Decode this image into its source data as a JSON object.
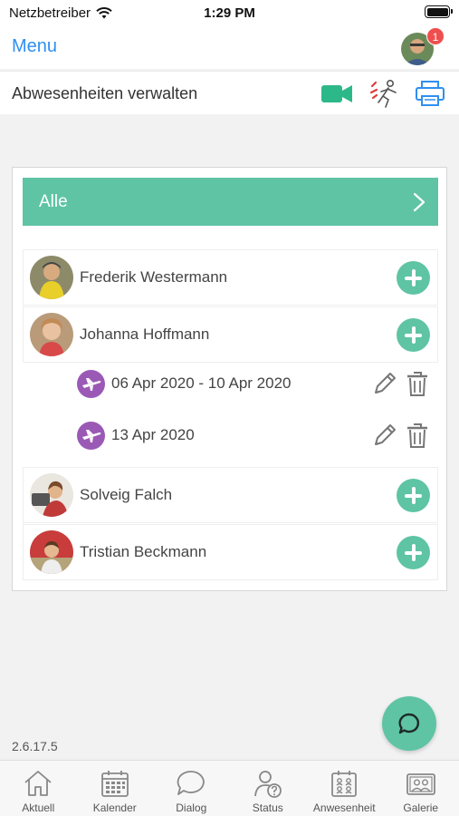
{
  "status_bar": {
    "carrier": "Netzbetreiber",
    "time": "1:29 PM"
  },
  "nav": {
    "menu_label": "Menu",
    "notification_count": "1"
  },
  "header": {
    "title": "Abwesenheiten verwalten"
  },
  "filter": {
    "label": "Alle"
  },
  "children": [
    {
      "name": "Frederik Westermann"
    },
    {
      "name": "Johanna Hoffmann",
      "absences": [
        "06 Apr 2020 - 10 Apr 2020",
        "13 Apr 2020"
      ]
    },
    {
      "name": "Solveig Falch"
    },
    {
      "name": "Tristian Beckmann"
    }
  ],
  "version": "2.6.17.5",
  "tabs": [
    {
      "label": "Aktuell",
      "icon": "home-icon"
    },
    {
      "label": "Kalender",
      "icon": "calendar-icon"
    },
    {
      "label": "Dialog",
      "icon": "chat-bubble-icon"
    },
    {
      "label": "Status",
      "icon": "person-question-icon"
    },
    {
      "label": "Anwesenheit",
      "icon": "attendance-icon"
    },
    {
      "label": "Galerie",
      "icon": "gallery-icon"
    }
  ],
  "colors": {
    "accent": "#5ec4a4",
    "link": "#2f8ff0",
    "absence": "#9b59b6",
    "badge": "#f04e4e"
  }
}
